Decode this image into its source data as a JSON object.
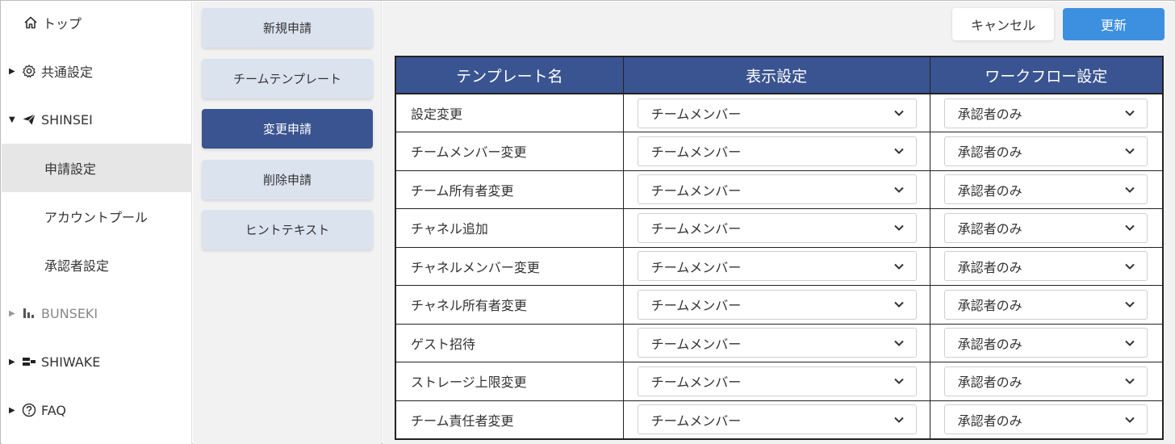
{
  "sidebar": {
    "items": [
      {
        "label": "トップ",
        "icon": "home-icon"
      },
      {
        "label": "共通設定",
        "icon": "gear-icon"
      },
      {
        "label": "SHINSEI",
        "icon": "paper-plane-icon"
      },
      {
        "label": "申請設定"
      },
      {
        "label": "アカウントプール"
      },
      {
        "label": "承認者設定"
      },
      {
        "label": "BUNSEKI",
        "icon": "bar-chart-icon"
      },
      {
        "label": "SHIWAKE",
        "icon": "sort-icon"
      },
      {
        "label": "FAQ",
        "icon": "help-circle-icon"
      }
    ]
  },
  "submenu": {
    "items": [
      {
        "label": "新規申請"
      },
      {
        "label": "チームテンプレート"
      },
      {
        "label": "変更申請"
      },
      {
        "label": "削除申請"
      },
      {
        "label": "ヒントテキスト"
      }
    ]
  },
  "toolbar": {
    "cancel_label": "キャンセル",
    "update_label": "更新"
  },
  "table": {
    "headers": [
      "テンプレート名",
      "表示設定",
      "ワークフロー設定"
    ],
    "rows": [
      {
        "name": "設定変更",
        "display": "チームメンバー",
        "workflow": "承認者のみ"
      },
      {
        "name": "チームメンバー変更",
        "display": "チームメンバー",
        "workflow": "承認者のみ"
      },
      {
        "name": "チーム所有者変更",
        "display": "チームメンバー",
        "workflow": "承認者のみ"
      },
      {
        "name": "チャネル追加",
        "display": "チームメンバー",
        "workflow": "承認者のみ"
      },
      {
        "name": "チャネルメンバー変更",
        "display": "チームメンバー",
        "workflow": "承認者のみ"
      },
      {
        "name": "チャネル所有者変更",
        "display": "チームメンバー",
        "workflow": "承認者のみ"
      },
      {
        "name": "ゲスト招待",
        "display": "チームメンバー",
        "workflow": "承認者のみ"
      },
      {
        "name": "ストレージ上限変更",
        "display": "チームメンバー",
        "workflow": "承認者のみ"
      },
      {
        "name": "チーム責任者変更",
        "display": "チームメンバー",
        "workflow": "承認者のみ"
      }
    ]
  },
  "colors": {
    "accent_navy": "#3a5491",
    "primary_blue": "#3d8fe0",
    "submenu_button": "#dbe3ef"
  }
}
